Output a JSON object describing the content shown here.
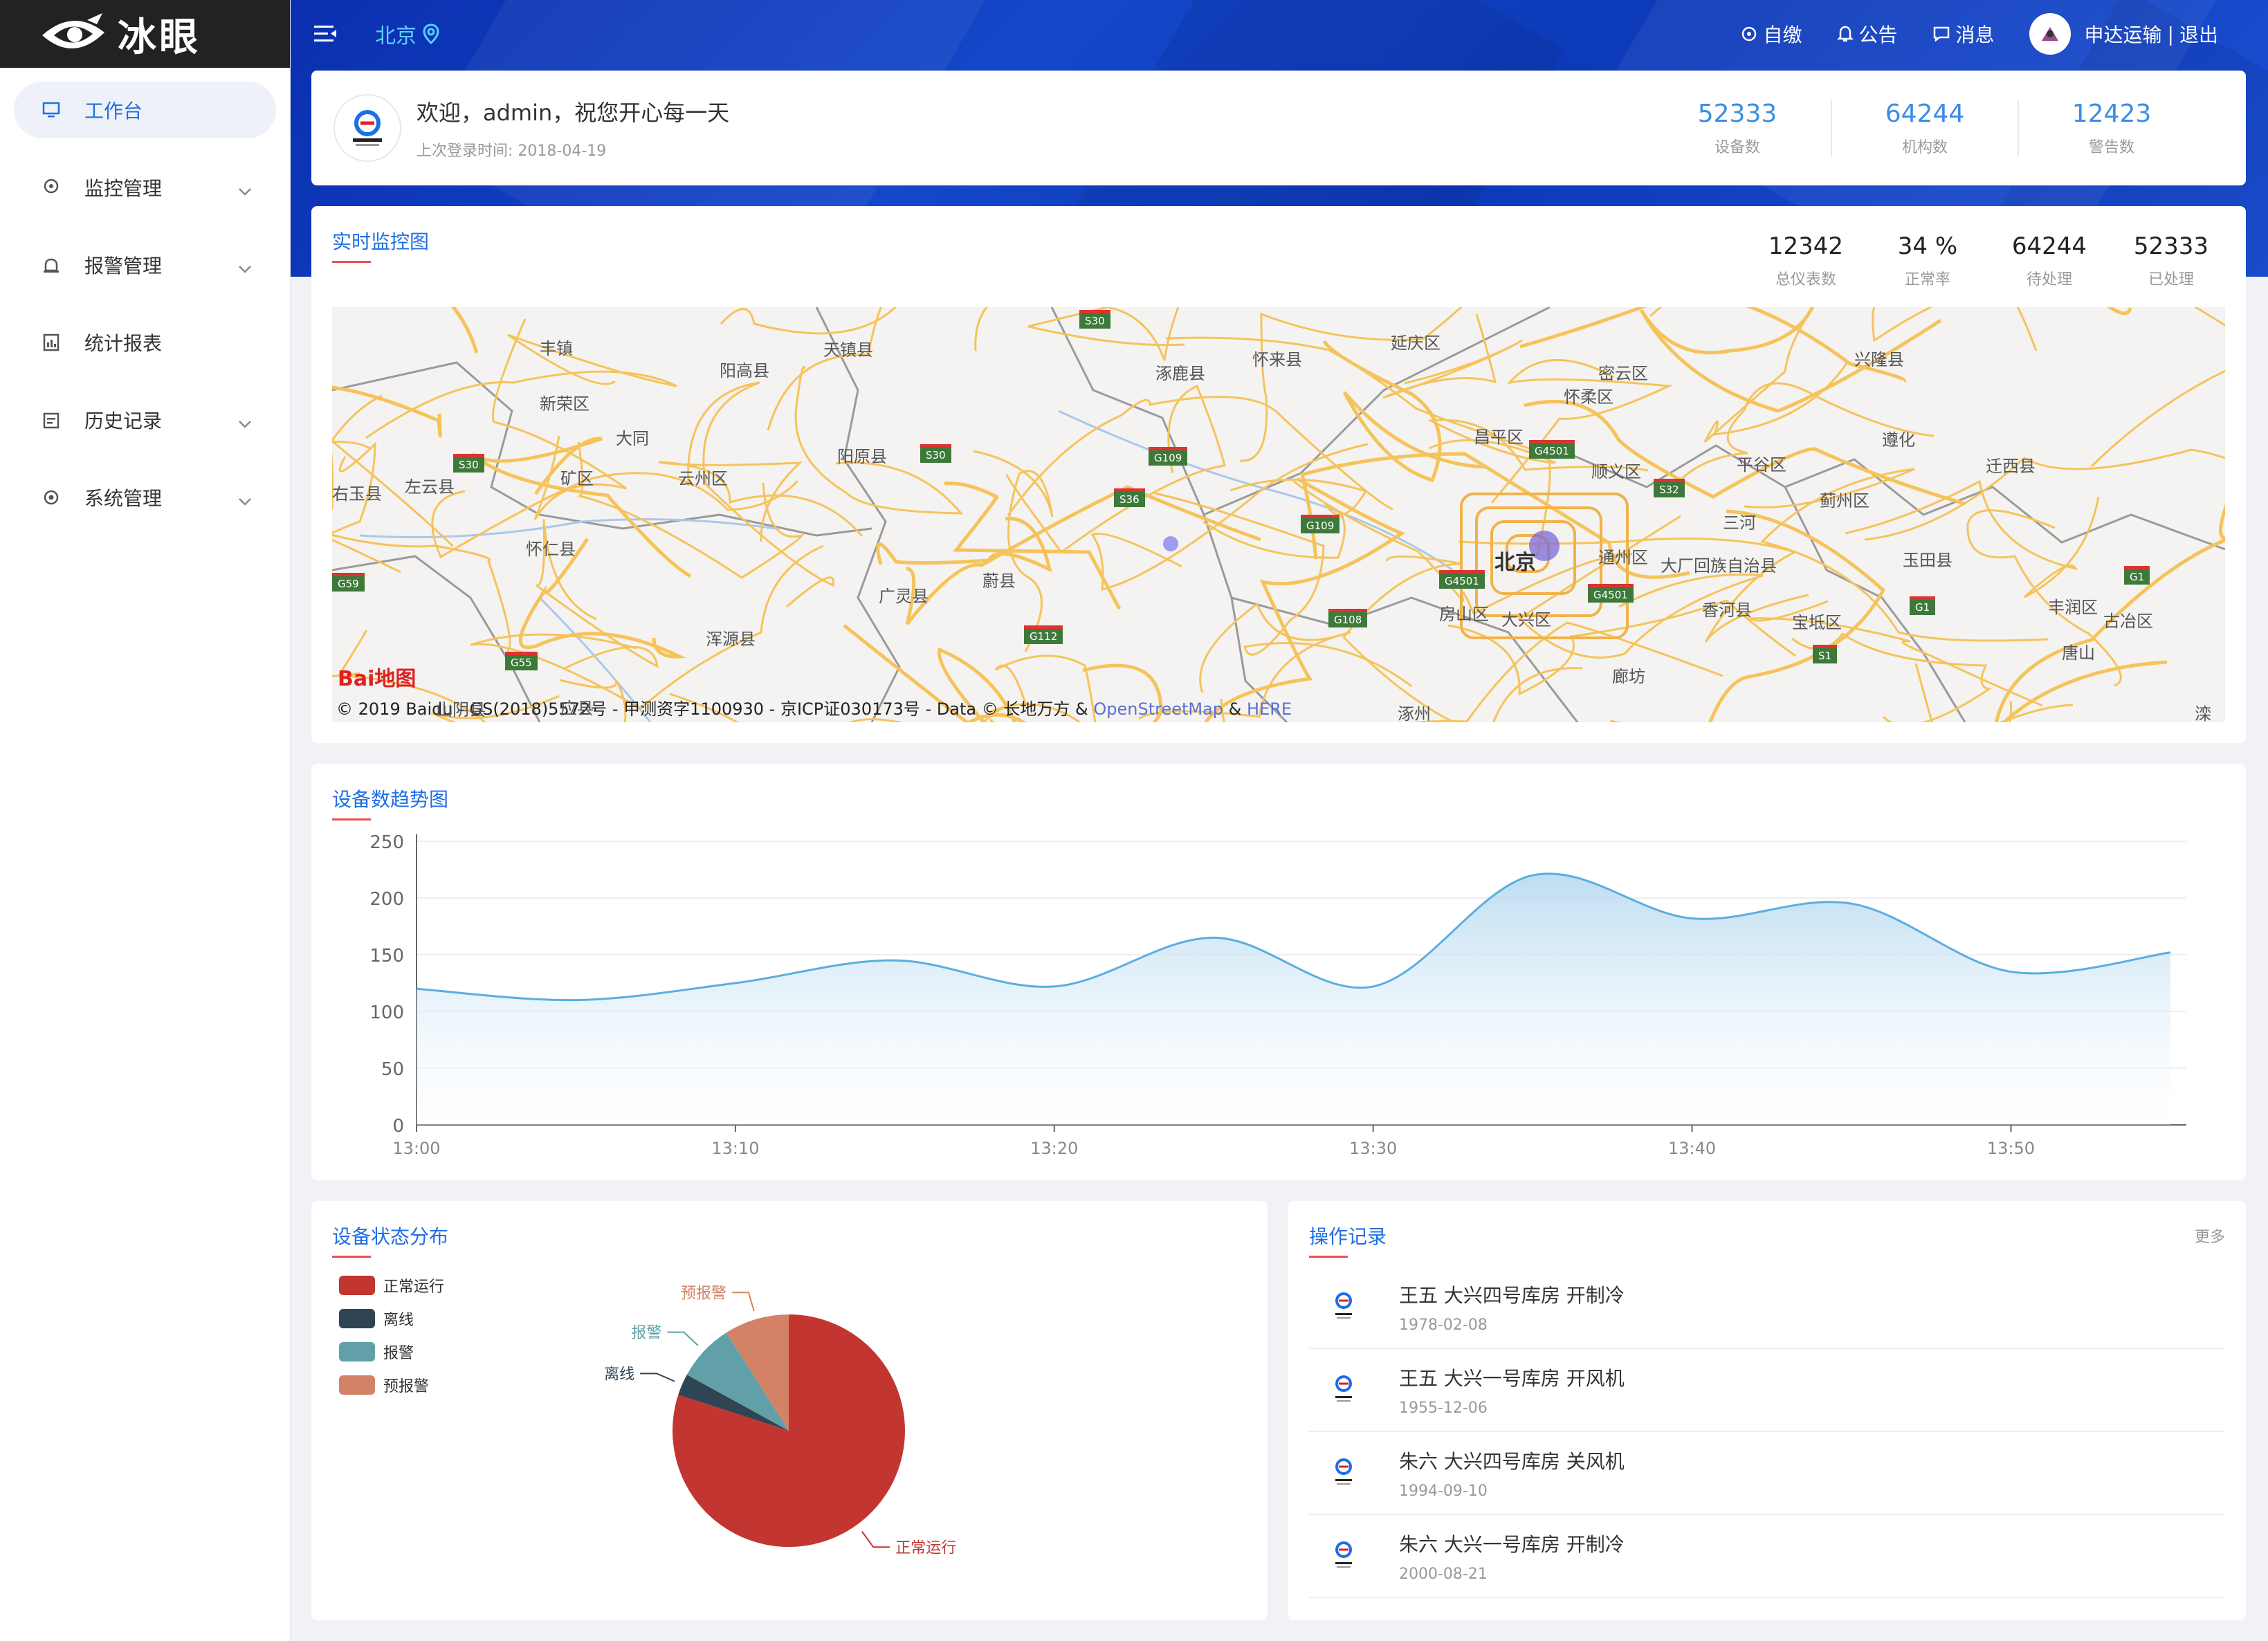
{
  "app": {
    "logo_text": "冰眼"
  },
  "sidebar": {
    "items": [
      {
        "label": "工作台",
        "icon": "monitor-icon",
        "active": true,
        "has_children": false
      },
      {
        "label": "监控管理",
        "icon": "location-icon",
        "active": false,
        "has_children": true
      },
      {
        "label": "报警管理",
        "icon": "alarm-icon",
        "active": false,
        "has_children": true
      },
      {
        "label": "统计报表",
        "icon": "chart-icon",
        "active": false,
        "has_children": false
      },
      {
        "label": "历史记录",
        "icon": "calendar-icon",
        "active": false,
        "has_children": true
      },
      {
        "label": "系统管理",
        "icon": "settings-icon",
        "active": false,
        "has_children": true
      }
    ]
  },
  "header": {
    "city": "北京",
    "links": [
      {
        "label": "自缴",
        "icon": "pay-icon"
      },
      {
        "label": "公告",
        "icon": "bell-icon"
      },
      {
        "label": "消息",
        "icon": "message-icon"
      }
    ],
    "user": "申达运输",
    "separator": "|",
    "logout": "退出"
  },
  "welcome": {
    "title": "欢迎，admin，祝您开心每一天",
    "last_login": "上次登录时间: 2018-04-19",
    "stats": [
      {
        "value": "52333",
        "label": "设备数"
      },
      {
        "value": "64244",
        "label": "机构数"
      },
      {
        "value": "12423",
        "label": "警告数"
      }
    ]
  },
  "monitor": {
    "title": "实时监控图",
    "stats": [
      {
        "value": "12342",
        "label": "总仪表数"
      },
      {
        "value": "34 %",
        "label": "正常率"
      },
      {
        "value": "64244",
        "label": "待处理"
      },
      {
        "value": "52333",
        "label": "已处理"
      }
    ],
    "map_credit": "© 2019 Baidu - GS(2018)5572号 - 甲测资字1100930 - 京ICP证030173号 - Data © 长地万方 & ",
    "map_credit_link1": "OpenStreetMap",
    "map_credit_amp": " & ",
    "map_credit_link2": "HERE",
    "map_logo": "Bai地图",
    "map_labels": [
      "丰镇",
      "天镇县",
      "阳高县",
      "新荣区",
      "大同",
      "阳原县",
      "矿区",
      "云州区",
      "左云县",
      "右玉县",
      "怀仁县",
      "浑源县",
      "应县",
      "山阴县",
      "广灵县",
      "蔚县",
      "涿鹿县",
      "怀来县",
      "延庆区",
      "密云区",
      "兴隆县",
      "怀柔区",
      "昌平区",
      "顺义区",
      "平谷区",
      "遵化",
      "迁西县",
      "蓟州区",
      "三河",
      "北京",
      "通州区",
      "大厂回族自治县",
      "玉田县",
      "房山区",
      "大兴区",
      "香河县",
      "宝坻区",
      "丰润区",
      "唐山",
      "古冶区",
      "廊坊",
      "涿州",
      "滦"
    ],
    "map_shields": [
      "S30",
      "S30",
      "S30",
      "G109",
      "S36",
      "G109",
      "G4501",
      "S32",
      "G4501",
      "G4501",
      "G108",
      "G112",
      "G55",
      "G59",
      "G1",
      "G1",
      "S1"
    ]
  },
  "trend": {
    "title": "设备数趋势图"
  },
  "chart_data": [
    {
      "type": "area",
      "title": "设备数趋势图",
      "xlabel": "",
      "ylabel": "",
      "x": [
        "13:00",
        "13:05",
        "13:10",
        "13:15",
        "13:20",
        "13:25",
        "13:30",
        "13:35",
        "13:40",
        "13:45",
        "13:50",
        "13:55"
      ],
      "x_ticks": [
        "13:00",
        "13:10",
        "13:20",
        "13:30",
        "13:40",
        "13:50"
      ],
      "values": [
        120,
        110,
        125,
        145,
        122,
        165,
        122,
        220,
        182,
        195,
        135,
        152
      ],
      "ylim": [
        0,
        250
      ],
      "y_ticks": [
        0,
        50,
        100,
        150,
        200,
        250
      ],
      "grid": true,
      "colors": {
        "line": "#5aaee0",
        "fill_top": "#b6d9f0",
        "fill_bottom": "#ffffff"
      }
    },
    {
      "type": "pie",
      "title": "设备状态分布",
      "categories": [
        "正常运行",
        "离线",
        "报警",
        "预报警"
      ],
      "values": [
        80,
        3,
        8,
        9
      ],
      "colors": [
        "#c23531",
        "#2f4554",
        "#61a0a8",
        "#d48265"
      ],
      "legend": "top-left"
    }
  ],
  "ops": {
    "title": "操作记录",
    "more": "更多",
    "items": [
      {
        "title": "王五 大兴四号库房 开制冷",
        "date": "1978-02-08"
      },
      {
        "title": "王五 大兴一号库房 开风机",
        "date": "1955-12-06"
      },
      {
        "title": "朱六 大兴四号库房 关风机",
        "date": "1994-09-10"
      },
      {
        "title": "朱六 大兴一号库房 开制冷",
        "date": "2000-08-21"
      }
    ]
  }
}
